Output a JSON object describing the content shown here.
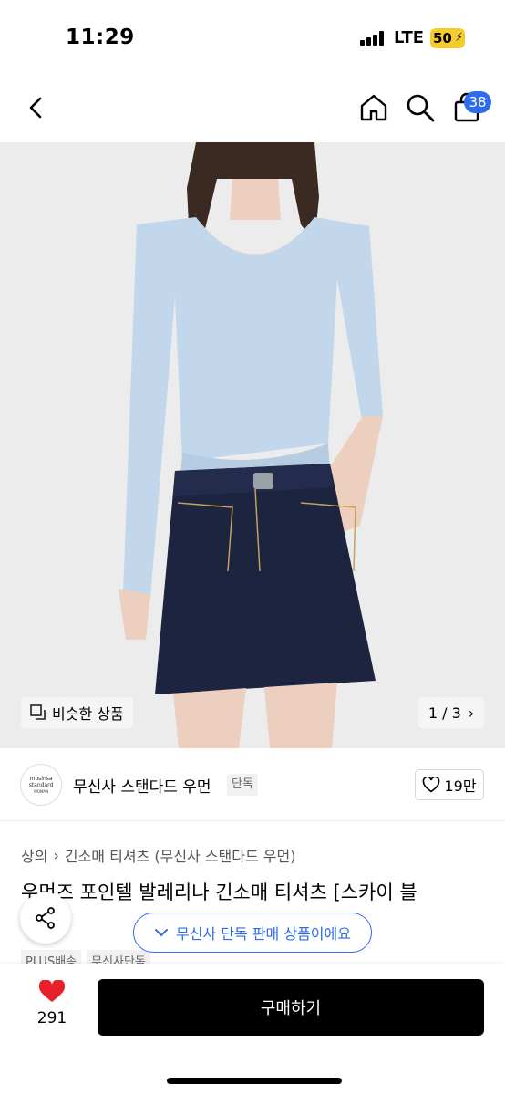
{
  "status_bar": {
    "time": "11:29",
    "network": "LTE",
    "battery": "50"
  },
  "nav": {
    "cart_count": "38"
  },
  "hero": {
    "similar_label": "비슷한 상품",
    "page_counter": "1 / 3"
  },
  "brand": {
    "logo_line1": "musinsa",
    "logo_line2": "standard",
    "logo_line3": "WOMAN",
    "name": "무신사 스탠다드 우먼",
    "tag": "단독",
    "likes": "19만"
  },
  "breadcrumb": [
    "상의",
    "긴소매 티셔츠 (무신사 스탠다드 우먼)"
  ],
  "product": {
    "title": "우먼즈 포인텔 발레리나 긴소매 티셔츠 [스카이 블",
    "tags": [
      "PLUS배송",
      "무신사단독"
    ]
  },
  "toast": {
    "text": "무신사 단독 판매 상품이에요"
  },
  "bottom": {
    "wish_count": "291",
    "buy_label": "구매하기"
  },
  "colors": {
    "accent": "#2f6bef",
    "heart": "#e8202a",
    "battery": "#f4cc2e"
  }
}
